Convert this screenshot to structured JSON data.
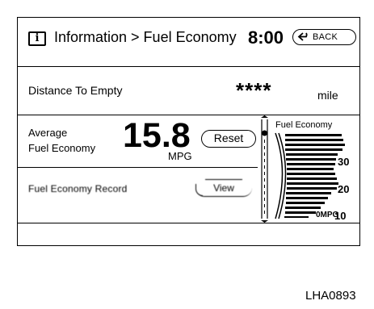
{
  "header": {
    "info_icon_glyph": "i",
    "breadcrumb": "Information > Fuel Economy",
    "clock": "8:00",
    "back_label": "BACK"
  },
  "distance_to_empty": {
    "label": "Distance To Empty",
    "value": "****",
    "unit": "mile"
  },
  "average_fuel_economy": {
    "label_line1": "Average",
    "label_line2": "Fuel Economy",
    "value": "15.8",
    "unit": "MPG",
    "reset_label": "Reset"
  },
  "fuel_economy_record": {
    "label": "Fuel Economy Record",
    "view_label": "View"
  },
  "graph": {
    "title": "Fuel Economy",
    "scale_labels": [
      "30",
      "20",
      "10"
    ],
    "zero_label": "0MPG",
    "scale_max": 35
  },
  "image_reference": "LHA0893"
}
